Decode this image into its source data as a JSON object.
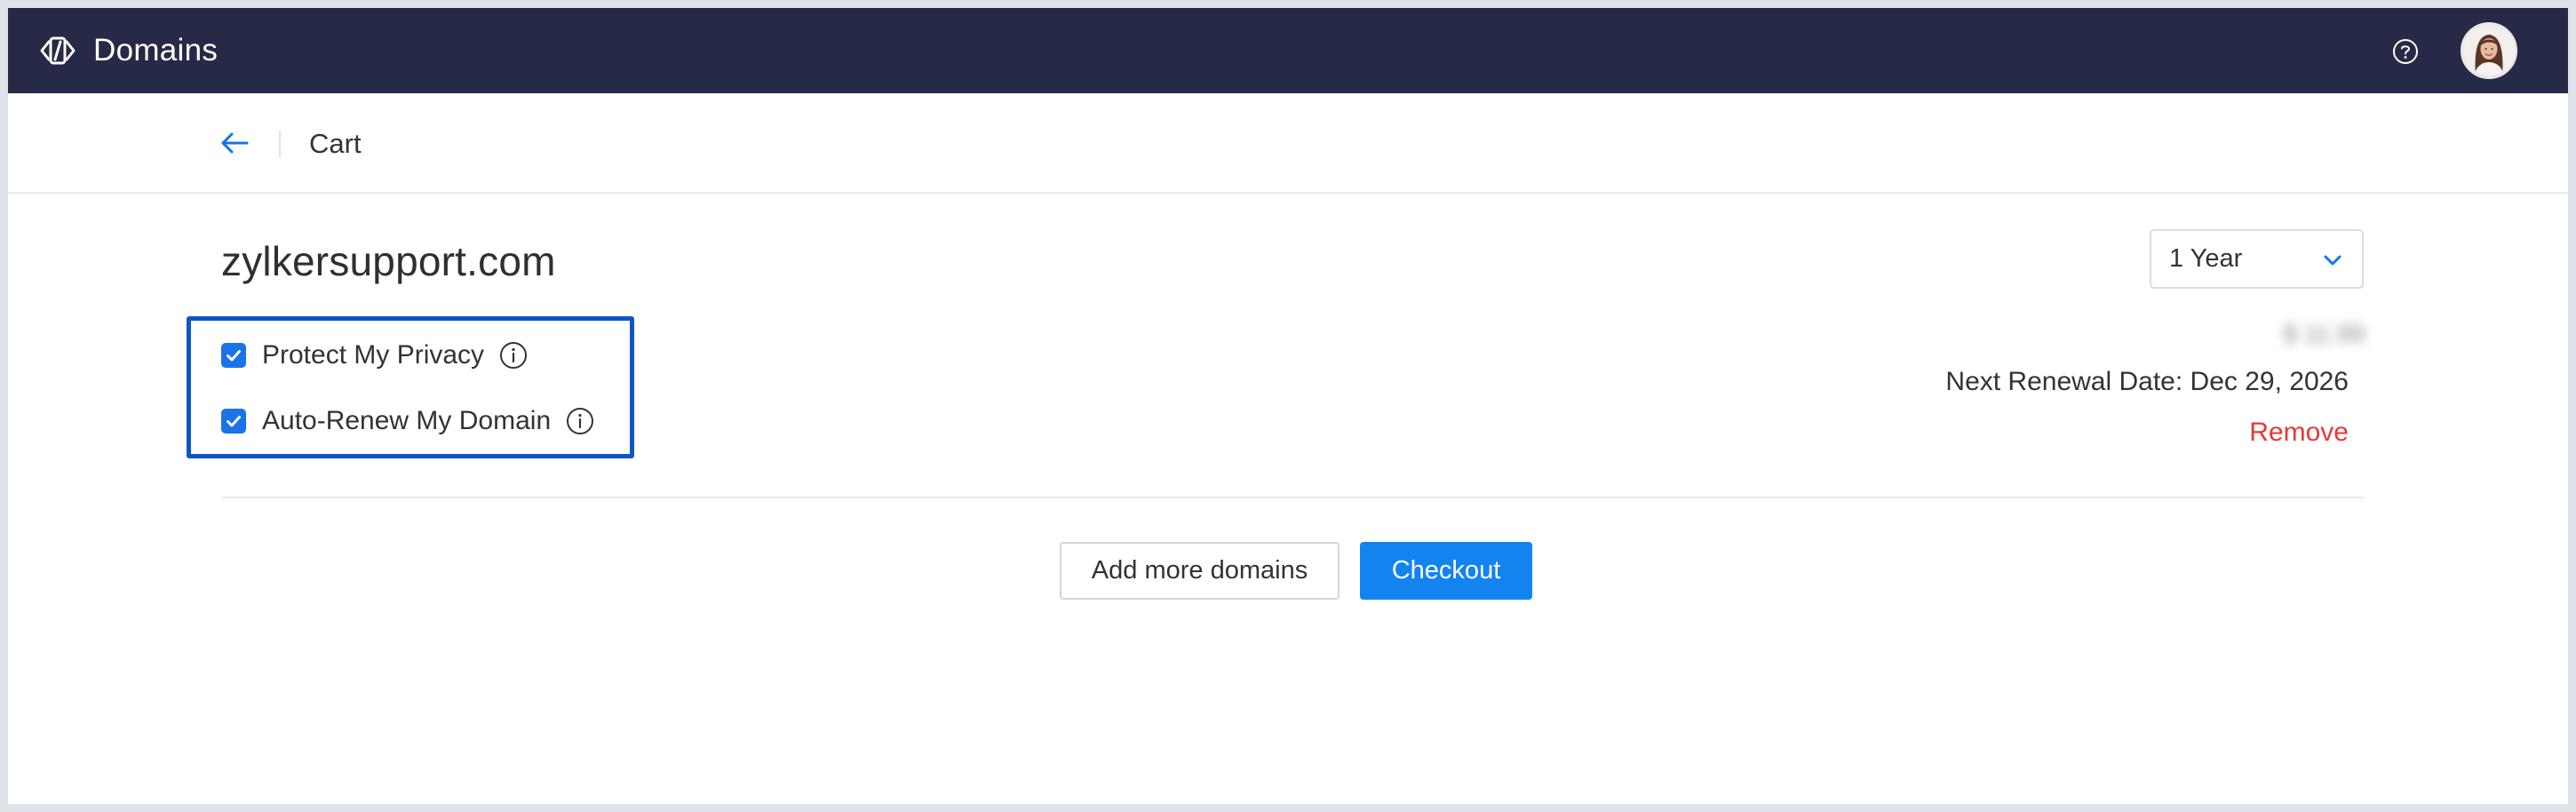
{
  "app": {
    "title": "Domains",
    "logo_icon": "domains-logo-icon",
    "help_icon": "question-circle-icon",
    "avatar_icon": "user-avatar"
  },
  "subheader": {
    "back_icon": "arrow-left-icon",
    "title": "Cart"
  },
  "cart_item": {
    "domain": "zylkersupport.com",
    "options": [
      {
        "label": "Protect My Privacy",
        "checked": true,
        "info_icon": "info-circle-icon"
      },
      {
        "label": "Auto-Renew My Domain",
        "checked": true,
        "info_icon": "info-circle-icon"
      }
    ],
    "term": {
      "selected": "1 Year",
      "chevron_icon": "chevron-down-icon"
    },
    "price": "$ 11.99",
    "renewal_text": "Next Renewal Date: Dec 29, 2026",
    "remove_label": "Remove"
  },
  "actions": {
    "add_more_label": "Add more domains",
    "checkout_label": "Checkout"
  },
  "colors": {
    "topbar": "#262a46",
    "accent": "#1383f0",
    "highlight_box": "#1155c4",
    "danger": "#e53935"
  }
}
